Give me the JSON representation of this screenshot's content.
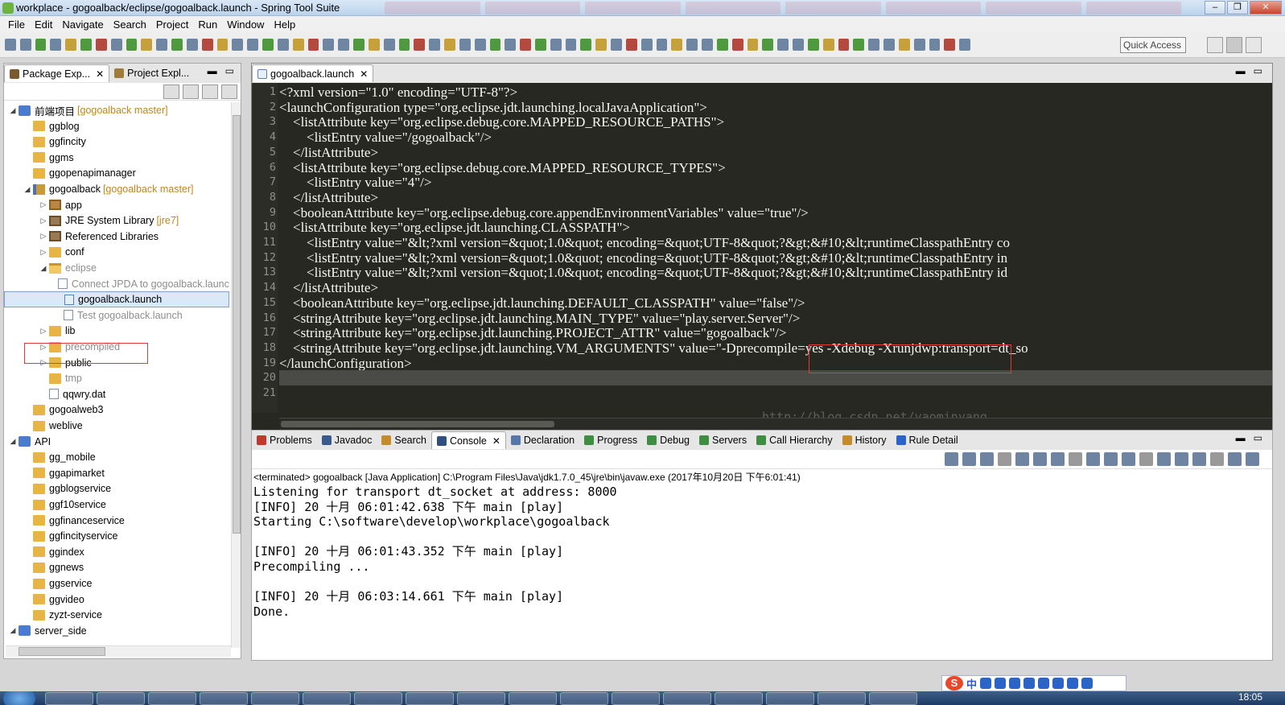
{
  "window": {
    "title": "workplace - gogoalback/eclipse/gogoalback.launch - Spring Tool Suite",
    "controls": [
      "‒",
      "❐",
      "✕"
    ]
  },
  "menu": [
    "File",
    "Edit",
    "Navigate",
    "Search",
    "Project",
    "Run",
    "Window",
    "Help"
  ],
  "toolbar": {
    "quick_access_placeholder": "Quick Access"
  },
  "package_explorer": {
    "tabs": [
      {
        "label": "Package Exp...",
        "active": true
      },
      {
        "label": "Project Expl...",
        "active": false
      }
    ],
    "tree": [
      {
        "label": "前端项目",
        "decor": "[gogoalback master]",
        "depth": 0,
        "expand": "open",
        "icon": "working-set",
        "dim": false
      },
      {
        "label": "ggblog",
        "decor": "",
        "depth": 1,
        "expand": "none",
        "icon": "folder",
        "dim": false
      },
      {
        "label": "ggfincity",
        "decor": "",
        "depth": 1,
        "expand": "none",
        "icon": "folder",
        "dim": false
      },
      {
        "label": "ggms",
        "decor": "",
        "depth": 1,
        "expand": "none",
        "icon": "folder",
        "dim": false
      },
      {
        "label": "ggopenapimanager",
        "decor": "",
        "depth": 1,
        "expand": "none",
        "icon": "folder",
        "dim": false
      },
      {
        "label": "gogoalback",
        "decor": "[gogoalback master]",
        "depth": 1,
        "expand": "open",
        "icon": "project",
        "dim": false
      },
      {
        "label": "app",
        "decor": "",
        "depth": 2,
        "expand": "closed",
        "icon": "package",
        "dim": false
      },
      {
        "label": "JRE System Library",
        "decor": "[jre7]",
        "depth": 2,
        "expand": "closed",
        "icon": "library",
        "dim": false
      },
      {
        "label": "Referenced Libraries",
        "decor": "",
        "depth": 2,
        "expand": "closed",
        "icon": "library",
        "dim": false
      },
      {
        "label": "conf",
        "decor": "",
        "depth": 2,
        "expand": "closed",
        "icon": "folder",
        "dim": false
      },
      {
        "label": "eclipse",
        "decor": "",
        "depth": 2,
        "expand": "open",
        "icon": "folder-open",
        "dim": true
      },
      {
        "label": "Connect JPDA to gogoalback.launch",
        "decor": "",
        "depth": 3,
        "expand": "none",
        "icon": "file",
        "dim": true
      },
      {
        "label": "gogoalback.launch",
        "decor": "",
        "depth": 3,
        "expand": "none",
        "icon": "launch",
        "dim": false,
        "selected": true
      },
      {
        "label": "Test gogoalback.launch",
        "decor": "",
        "depth": 3,
        "expand": "none",
        "icon": "file",
        "dim": true
      },
      {
        "label": "lib",
        "decor": "",
        "depth": 2,
        "expand": "closed",
        "icon": "folder",
        "dim": false
      },
      {
        "label": "precompiled",
        "decor": "",
        "depth": 2,
        "expand": "closed",
        "icon": "folder",
        "dim": true
      },
      {
        "label": "public",
        "decor": "",
        "depth": 2,
        "expand": "closed",
        "icon": "folder",
        "dim": false
      },
      {
        "label": "tmp",
        "decor": "",
        "depth": 2,
        "expand": "none",
        "icon": "folder",
        "dim": true
      },
      {
        "label": "qqwry.dat",
        "decor": "",
        "depth": 2,
        "expand": "none",
        "icon": "file",
        "dim": false
      },
      {
        "label": "gogoalweb3",
        "decor": "",
        "depth": 1,
        "expand": "none",
        "icon": "folder",
        "dim": false
      },
      {
        "label": "weblive",
        "decor": "",
        "depth": 1,
        "expand": "none",
        "icon": "folder",
        "dim": false
      },
      {
        "label": "API",
        "decor": "",
        "depth": 0,
        "expand": "open",
        "icon": "working-set",
        "dim": false
      },
      {
        "label": "gg_mobile",
        "decor": "",
        "depth": 1,
        "expand": "none",
        "icon": "folder",
        "dim": false
      },
      {
        "label": "ggapimarket",
        "decor": "",
        "depth": 1,
        "expand": "none",
        "icon": "folder",
        "dim": false
      },
      {
        "label": "ggblogservice",
        "decor": "",
        "depth": 1,
        "expand": "none",
        "icon": "folder",
        "dim": false
      },
      {
        "label": "ggf10service",
        "decor": "",
        "depth": 1,
        "expand": "none",
        "icon": "folder",
        "dim": false
      },
      {
        "label": "ggfinanceservice",
        "decor": "",
        "depth": 1,
        "expand": "none",
        "icon": "folder",
        "dim": false
      },
      {
        "label": "ggfincityservice",
        "decor": "",
        "depth": 1,
        "expand": "none",
        "icon": "folder",
        "dim": false
      },
      {
        "label": "ggindex",
        "decor": "",
        "depth": 1,
        "expand": "none",
        "icon": "folder",
        "dim": false
      },
      {
        "label": "ggnews",
        "decor": "",
        "depth": 1,
        "expand": "none",
        "icon": "folder",
        "dim": false
      },
      {
        "label": "ggservice",
        "decor": "",
        "depth": 1,
        "expand": "none",
        "icon": "folder",
        "dim": false
      },
      {
        "label": "ggvideo",
        "decor": "",
        "depth": 1,
        "expand": "none",
        "icon": "folder",
        "dim": false
      },
      {
        "label": "zyzt-service",
        "decor": "",
        "depth": 1,
        "expand": "none",
        "icon": "folder",
        "dim": false
      },
      {
        "label": "server_side",
        "decor": "",
        "depth": 0,
        "expand": "open",
        "icon": "working-set",
        "dim": false
      }
    ]
  },
  "editor": {
    "tab": "gogoalback.launch",
    "lines": [
      "<?xml version=\"1.0\" encoding=\"UTF-8\"?>",
      "<launchConfiguration type=\"org.eclipse.jdt.launching.localJavaApplication\">",
      "    <listAttribute key=\"org.eclipse.debug.core.MAPPED_RESOURCE_PATHS\">",
      "        <listEntry value=\"/gogoalback\"/>",
      "    </listAttribute>",
      "    <listAttribute key=\"org.eclipse.debug.core.MAPPED_RESOURCE_TYPES\">",
      "        <listEntry value=\"4\"/>",
      "    </listAttribute>",
      "    <booleanAttribute key=\"org.eclipse.debug.core.appendEnvironmentVariables\" value=\"true\"/>",
      "    <listAttribute key=\"org.eclipse.jdt.launching.CLASSPATH\">",
      "        <listEntry value=\"&lt;?xml version=&quot;1.0&quot; encoding=&quot;UTF-8&quot;?&gt;&#10;&lt;runtimeClasspathEntry co",
      "        <listEntry value=\"&lt;?xml version=&quot;1.0&quot; encoding=&quot;UTF-8&quot;?&gt;&#10;&lt;runtimeClasspathEntry in",
      "        <listEntry value=\"&lt;?xml version=&quot;1.0&quot; encoding=&quot;UTF-8&quot;?&gt;&#10;&lt;runtimeClasspathEntry id",
      "    </listAttribute>",
      "    <booleanAttribute key=\"org.eclipse.jdt.launching.DEFAULT_CLASSPATH\" value=\"false\"/>",
      "    <stringAttribute key=\"org.eclipse.jdt.launching.MAIN_TYPE\" value=\"play.server.Server\"/>",
      "    <stringAttribute key=\"org.eclipse.jdt.launching.PROJECT_ATTR\" value=\"gogoalback\"/>",
      "    <stringAttribute key=\"org.eclipse.jdt.launching.VM_ARGUMENTS\" value=\"-Dprecompile=yes -Xdebug -Xrunjdwp:transport=dt_so",
      "</launchConfiguration>",
      "",
      ""
    ],
    "current_line_index": 19,
    "watermark": "http://blog.csdn.net/yaominyang"
  },
  "bottom_tabs": [
    {
      "label": "Problems",
      "active": false,
      "color": "#c0392b"
    },
    {
      "label": "Javadoc",
      "active": false,
      "color": "#3b5a8c"
    },
    {
      "label": "Search",
      "active": false,
      "color": "#c48a2c"
    },
    {
      "label": "Console",
      "active": true,
      "color": "#2f4f7f"
    },
    {
      "label": "Declaration",
      "active": false,
      "color": "#5577aa"
    },
    {
      "label": "Progress",
      "active": false,
      "color": "#3e8e41"
    },
    {
      "label": "Debug",
      "active": false,
      "color": "#3e8e41"
    },
    {
      "label": "Servers",
      "active": false,
      "color": "#3e8e41"
    },
    {
      "label": "Call Hierarchy",
      "active": false,
      "color": "#3e8e41"
    },
    {
      "label": "History",
      "active": false,
      "color": "#c48a2c"
    },
    {
      "label": "Rule Detail",
      "active": false,
      "color": "#2a64c8"
    }
  ],
  "console": {
    "status": "<terminated> gogoalback [Java Application] C:\\Program Files\\Java\\jdk1.7.0_45\\jre\\bin\\javaw.exe (2017年10月20日 下午6:01:41)",
    "lines": [
      "Listening for transport dt_socket at address: 8000",
      "[INFO] 20 十月 06:01:42.638 下午 main [play]",
      "Starting C:\\software\\develop\\workplace\\gogoalback",
      "",
      "[INFO] 20 十月 06:01:43.352 下午 main [play]",
      "Precompiling ...",
      "",
      "[INFO] 20 十月 06:03:14.661 下午 main [play]",
      "Done."
    ]
  },
  "ime": {
    "logo": "S",
    "mode": "中"
  },
  "taskbar": {
    "clock": "18:05"
  }
}
